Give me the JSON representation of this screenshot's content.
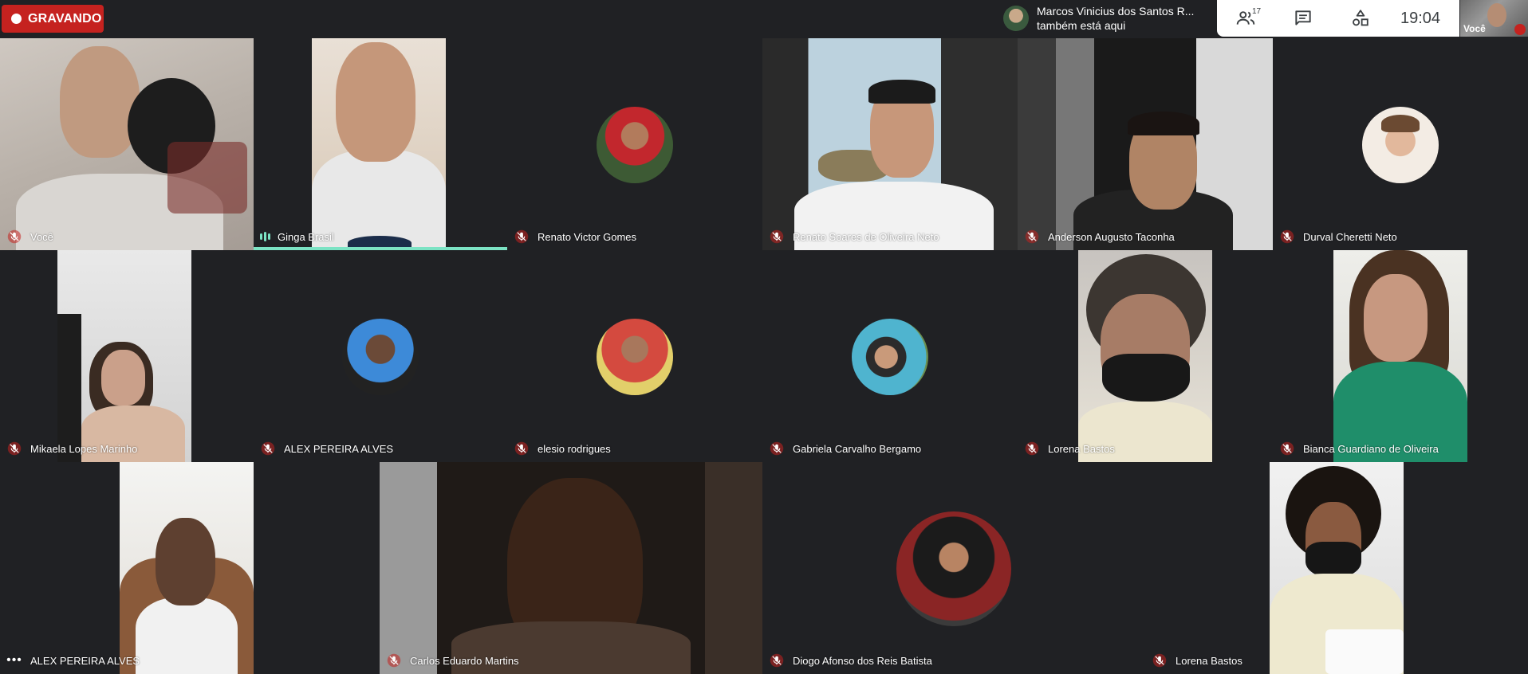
{
  "recording": {
    "label": "GRAVANDO"
  },
  "notification": {
    "name": "Marcos Vinicius dos Santos R...",
    "message": "também está aqui"
  },
  "toolbar": {
    "participants_count": "17",
    "participants_icon": "people-icon",
    "chat_icon": "chat-icon",
    "activities_icon": "activities-icon",
    "time": "19:04"
  },
  "self_preview": {
    "label": "Você"
  },
  "participants": [
    {
      "name": "Você",
      "muted": true
    },
    {
      "name": "Ginga Brasil",
      "muted": false,
      "speaking": true
    },
    {
      "name": "Renato Victor Gomes",
      "muted": true
    },
    {
      "name": "Renato Soares de Oliveira Neto",
      "muted": true
    },
    {
      "name": "Anderson Augusto Taconha",
      "muted": true
    },
    {
      "name": "Durval Cheretti Neto",
      "muted": true
    },
    {
      "name": "Mikaela Lopes Marinho",
      "muted": true
    },
    {
      "name": "ALEX PEREIRA ALVES",
      "muted": true
    },
    {
      "name": "elesio rodrigues",
      "muted": true
    },
    {
      "name": "Gabriela Carvalho Bergamo",
      "muted": true
    },
    {
      "name": "Lorena Bastos",
      "muted": true
    },
    {
      "name": "Bianca Guardiano de Oliveira",
      "muted": true
    },
    {
      "name": "ALEX PEREIRA ALVES",
      "muted": false
    },
    {
      "name": "Carlos Eduardo Martins",
      "muted": true
    },
    {
      "name": "Diogo Afonso dos Reis Batista",
      "muted": true
    },
    {
      "name": "Lorena Bastos",
      "muted": true
    }
  ],
  "colors": {
    "background": "#202124",
    "recording": "#c5221f",
    "speaking": "#7ce3c4",
    "muted_mic": "#c5221f"
  }
}
